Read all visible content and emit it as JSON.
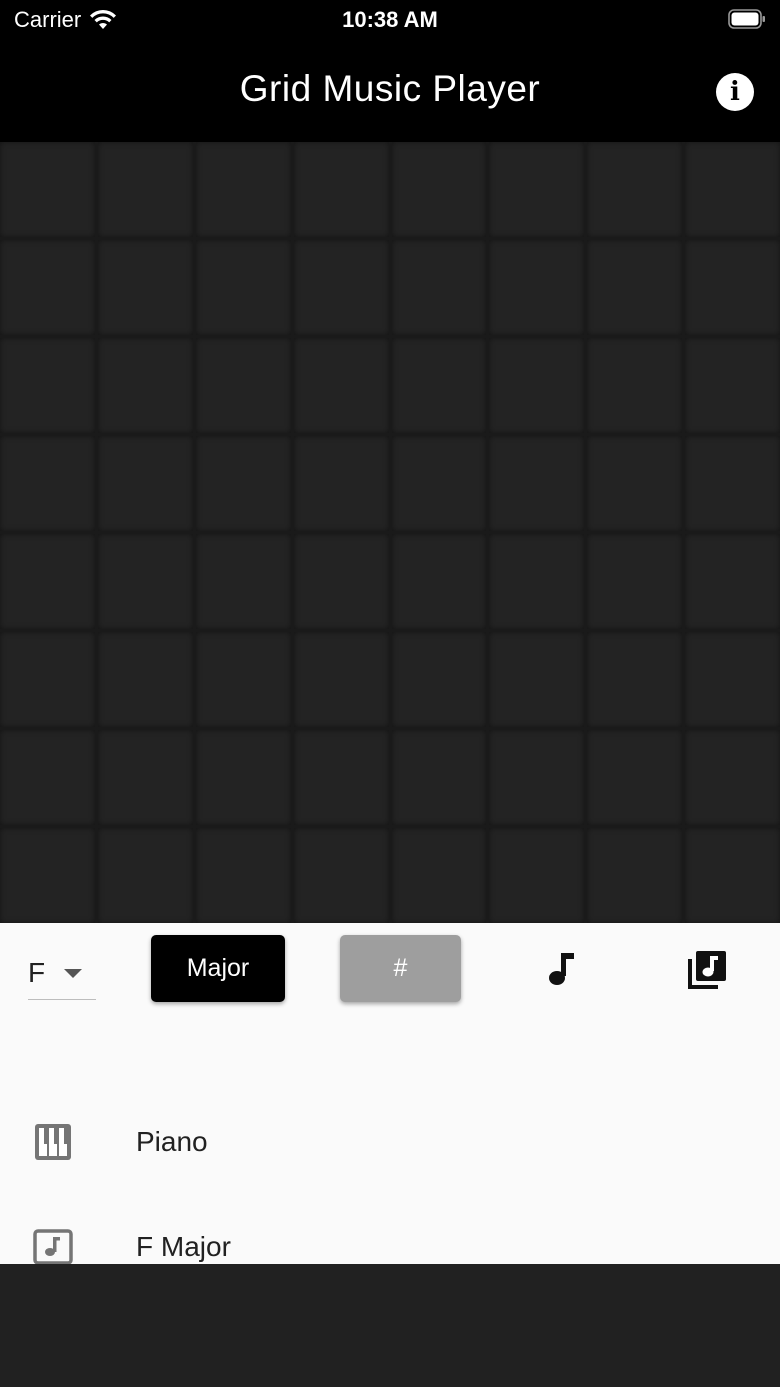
{
  "status_bar": {
    "carrier": "Carrier",
    "time": "10:38 AM",
    "wifi_icon": "wifi-icon",
    "battery_icon": "battery-icon"
  },
  "app_bar": {
    "title": "Grid Music Player",
    "info_icon": "info-icon",
    "background": "#000000"
  },
  "grid": {
    "columns": 8,
    "rows": 8,
    "cell_color": "#232323"
  },
  "controls": {
    "key_value": "F",
    "scale_label": "Major",
    "sharp_label": "#",
    "note_icon": "music-note-icon",
    "library_icon": "music-library-icon",
    "scale_button_color": "#000000",
    "sharp_button_color": "#9e9e9e"
  },
  "list": [
    {
      "icon": "piano-icon",
      "label": "Piano"
    },
    {
      "icon": "music-box-icon",
      "label": "F Major"
    }
  ]
}
